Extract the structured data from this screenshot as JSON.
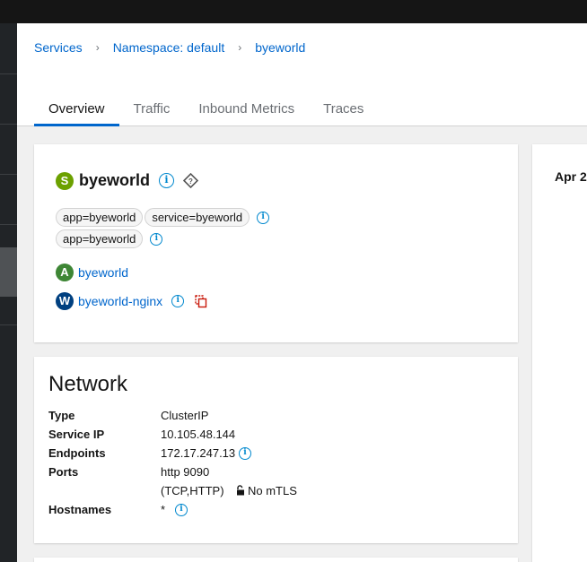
{
  "breadcrumb": [
    {
      "label": "Services"
    },
    {
      "label": "Namespace: default"
    },
    {
      "label": "byeworld"
    }
  ],
  "tabs": [
    {
      "label": "Overview",
      "active": true
    },
    {
      "label": "Traffic",
      "active": false
    },
    {
      "label": "Inbound Metrics",
      "active": false
    },
    {
      "label": "Traces",
      "active": false
    }
  ],
  "service": {
    "badge": "S",
    "name": "byeworld",
    "labels_row1": [
      "app=byeworld",
      "service=byeworld"
    ],
    "labels_row2": [
      "app=byeworld"
    ],
    "app": {
      "badge": "A",
      "name": "byeworld"
    },
    "workload": {
      "badge": "W",
      "name": "byeworld-nginx"
    }
  },
  "network": {
    "title": "Network",
    "rows": [
      {
        "key": "Type",
        "value": "ClusterIP"
      },
      {
        "key": "Service IP",
        "value": "10.105.48.144"
      },
      {
        "key": "Endpoints",
        "value": "172.17.247.13"
      },
      {
        "key": "Ports",
        "value": "http 9090"
      },
      {
        "key": "",
        "value": "(TCP,HTTP)"
      },
      {
        "key": "Hostnames",
        "value": "*"
      }
    ],
    "mtls": "No mTLS"
  },
  "right_panel": {
    "date_partial": "Apr 2"
  },
  "colors": {
    "service_badge": "#6ca100",
    "app_badge": "#3e8635",
    "workload_badge": "#004080",
    "link": "#0066cc",
    "info": "#0088ce",
    "danger": "#c9190b"
  },
  "icons": [
    "chevron-right-icon",
    "info-icon",
    "question-diamond-icon",
    "copy-icon",
    "lock-open-icon"
  ]
}
